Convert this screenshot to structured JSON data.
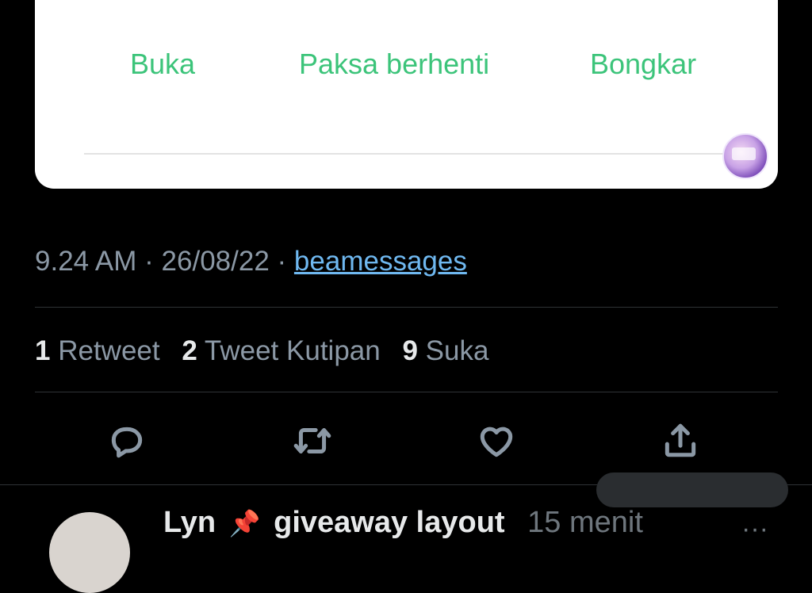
{
  "dialog": {
    "buttons": [
      {
        "label": "Buka"
      },
      {
        "label": "Paksa berhenti"
      },
      {
        "label": "Bongkar"
      }
    ]
  },
  "tweet": {
    "time": "9.24 AM",
    "separator": "·",
    "date": "26/08/22",
    "source": "beamessages",
    "stats": {
      "retweets_count": "1",
      "retweets_label": "Retweet",
      "quotes_count": "2",
      "quotes_label": "Tweet Kutipan",
      "likes_count": "9",
      "likes_label": "Suka"
    },
    "actions": [
      {
        "icon": "reply-icon"
      },
      {
        "icon": "retweet-icon"
      },
      {
        "icon": "heart-icon"
      },
      {
        "icon": "share-icon"
      }
    ]
  },
  "next_tweet": {
    "name": "Lyn",
    "pin": "📌",
    "title": "giveaway layout",
    "time": "15 menit",
    "more": "···"
  },
  "colors": {
    "accent_green": "#3cc47a",
    "link_blue": "#6fb8f0",
    "muted_text": "#8b98a5",
    "background": "#000000"
  }
}
